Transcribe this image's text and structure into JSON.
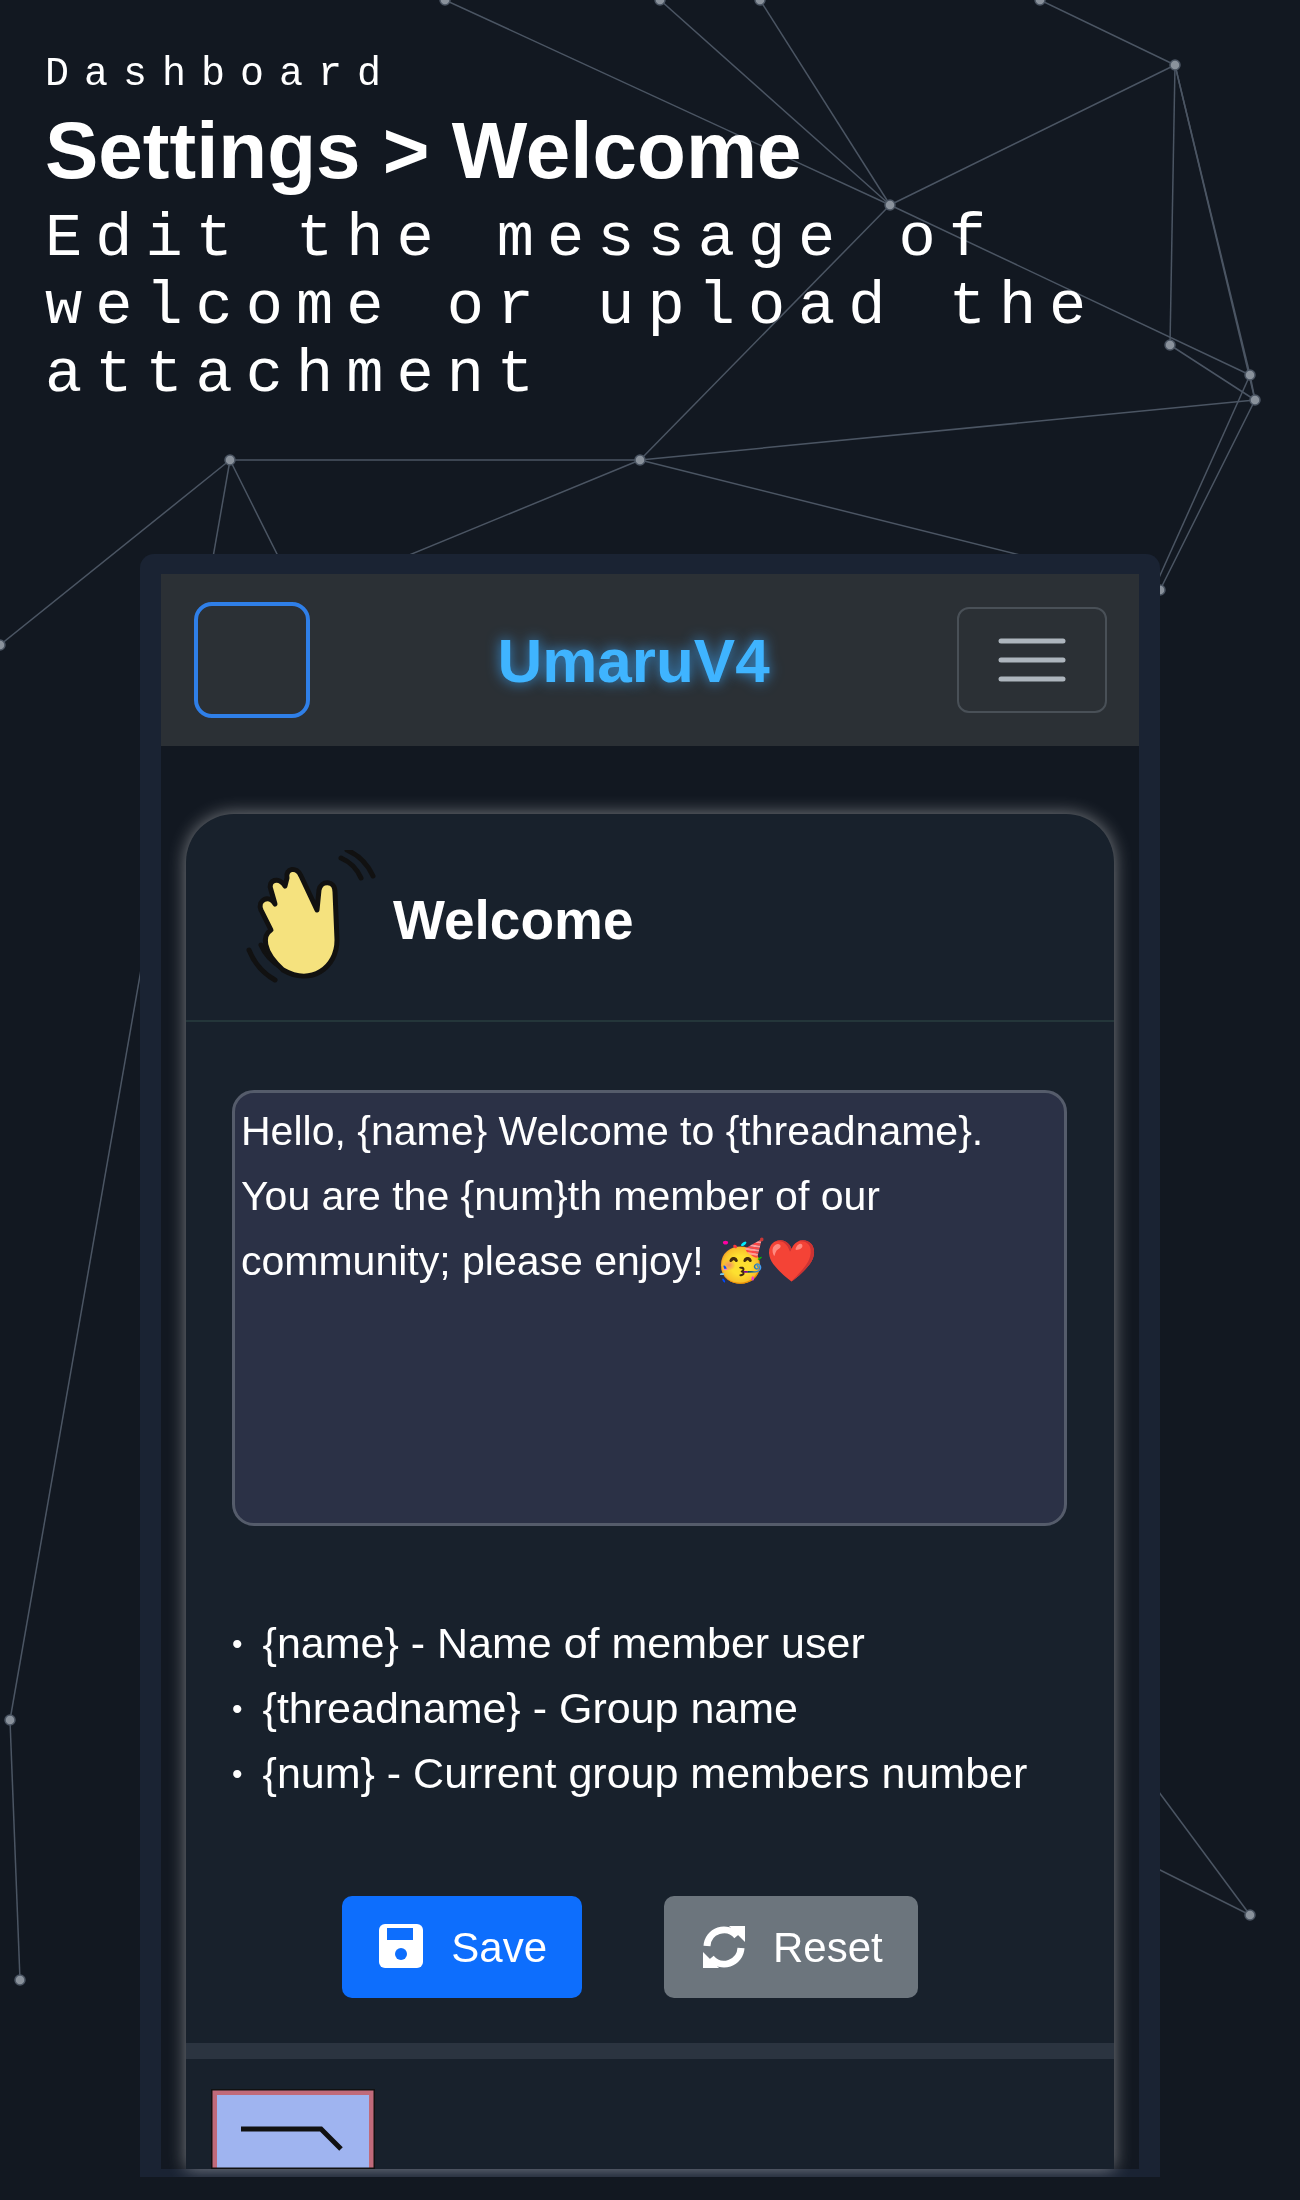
{
  "header": {
    "breadcrumb": "Dashboard",
    "title": "Settings > Welcome",
    "subtitle": "Edit the message of welcome or upload the attachment"
  },
  "navbar": {
    "brand": "UmaruV4"
  },
  "card": {
    "title": "Welcome",
    "message": "Hello, {name} Welcome to {threadname}. You are the {num}th member of our community; please enjoy! 🥳❤️",
    "variables": [
      {
        "bullet": "•",
        "text": "{name} - Name of member user"
      },
      {
        "bullet": "•",
        "text": "{threadname} - Group name"
      },
      {
        "bullet": "•",
        "text": "{num} - Current group members number"
      }
    ],
    "buttons": [
      {
        "label": "Save",
        "kind": "primary"
      },
      {
        "label": "Reset",
        "kind": "secondary"
      }
    ]
  }
}
